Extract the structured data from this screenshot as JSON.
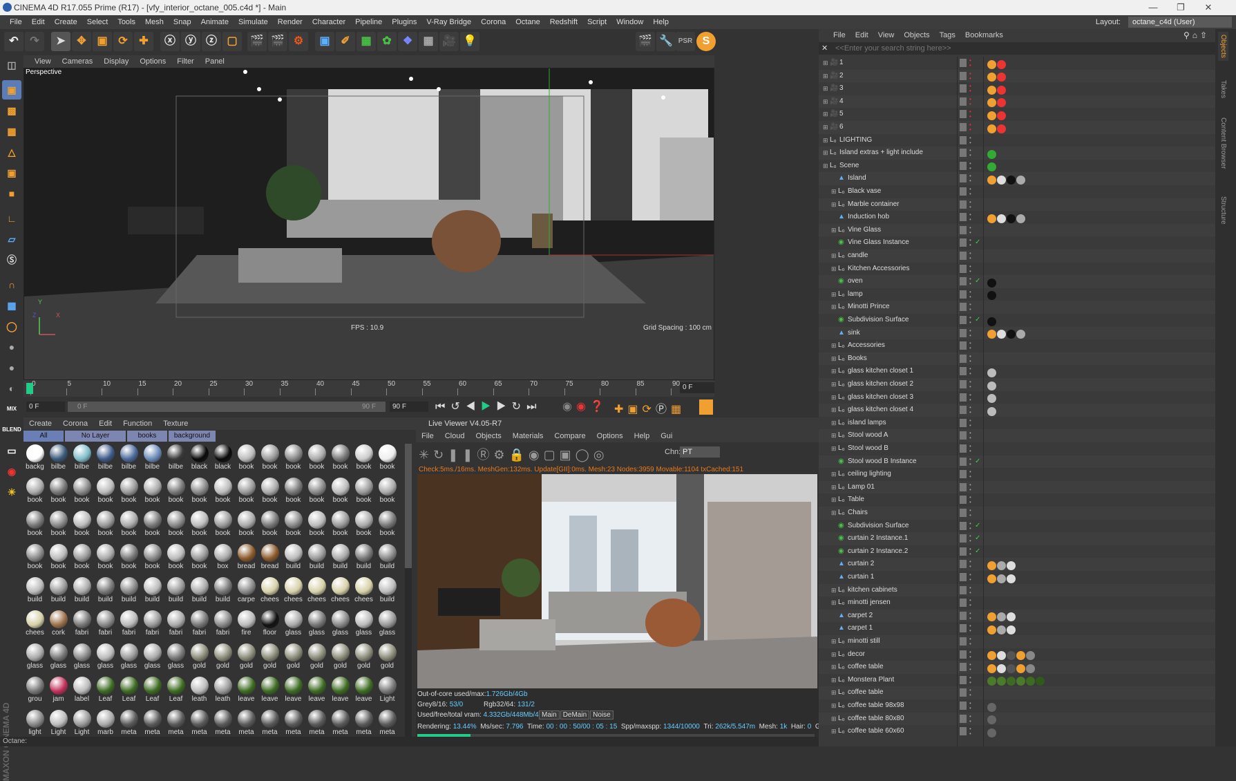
{
  "window": {
    "title": "CINEMA 4D R17.055 Prime (R17) - [vfy_interior_octane_005.c4d *] - Main"
  },
  "menubar": {
    "items": [
      "File",
      "Edit",
      "Create",
      "Select",
      "Tools",
      "Mesh",
      "Snap",
      "Animate",
      "Simulate",
      "Render",
      "Character",
      "Pipeline",
      "Plugins",
      "V-Ray Bridge",
      "Corona",
      "Octane",
      "Redshift",
      "Script",
      "Window",
      "Help"
    ],
    "layout_label": "Layout:",
    "layout_value": "octane_c4d (User)"
  },
  "viewport": {
    "menu": [
      "View",
      "Cameras",
      "Display",
      "Options",
      "Filter",
      "Panel"
    ],
    "label": "Perspective",
    "fps": "FPS : 10.9",
    "grid_spacing": "Grid Spacing : 100 cm",
    "axis_y": "Y",
    "axis_x": "X",
    "axis_z": "Z"
  },
  "timeline": {
    "ticks": [
      "0",
      "5",
      "10",
      "15",
      "20",
      "25",
      "30",
      "35",
      "40",
      "45",
      "50",
      "55",
      "60",
      "65",
      "70",
      "75",
      "80",
      "85",
      "90"
    ],
    "current_frame": "0 F",
    "start_field": "0 F",
    "range_start": "0 F",
    "range_end": "90 F",
    "end_field": "90 F"
  },
  "material_manager": {
    "menu": [
      "Create",
      "Corona",
      "Edit",
      "Function",
      "Texture"
    ],
    "filters": [
      "All",
      "No Layer",
      "books",
      "background"
    ],
    "materials": [
      "backg",
      "bilbe",
      "bilbe",
      "bilbe",
      "bilbe",
      "bilbe",
      "bilbe",
      "black",
      "black",
      "book",
      "book",
      "book",
      "book",
      "book",
      "book",
      "book",
      "book",
      "book",
      "book",
      "book",
      "book",
      "book",
      "book",
      "book",
      "book",
      "book",
      "book",
      "book",
      "book",
      "book",
      "book",
      "book",
      "book",
      "book",
      "book",
      "book",
      "book",
      "book",
      "book",
      "book",
      "book",
      "book",
      "book",
      "book",
      "book",
      "book",
      "book",
      "book",
      "book",
      "book",
      "book",
      "book",
      "book",
      "book",
      "book",
      "book",
      "box",
      "bread",
      "bread",
      "build",
      "build",
      "build",
      "build",
      "build",
      "build",
      "build",
      "build",
      "build",
      "build",
      "build",
      "build",
      "build",
      "build",
      "carpe",
      "chees",
      "chees",
      "chees",
      "chees",
      "chees",
      "build",
      "chees",
      "cork",
      "fabri",
      "fabri",
      "fabri",
      "fabri",
      "fabri",
      "fabri",
      "fabri",
      "fire",
      "floor",
      "glass",
      "glass",
      "glass",
      "glass",
      "glass",
      "glass",
      "glass",
      "glass",
      "glass",
      "glass",
      "glass",
      "glass",
      "gold",
      "gold",
      "gold",
      "gold",
      "gold",
      "gold",
      "gold",
      "gold",
      "gold",
      "grou",
      "jam",
      "label",
      "Leaf",
      "Leaf",
      "Leaf",
      "Leaf",
      "leath",
      "leath",
      "leave",
      "leave",
      "leave",
      "leave",
      "leave",
      "leave",
      "Light",
      "light",
      "Light",
      "Light",
      "marb",
      "meta",
      "meta",
      "meta",
      "meta",
      "meta",
      "meta",
      "meta",
      "meta",
      "meta",
      "meta",
      "meta",
      "meta"
    ],
    "brand": "MAXON CINEMA 4D"
  },
  "live_viewer": {
    "title": "Live Viewer V4.05-R7",
    "menu": [
      "File",
      "Cloud",
      "Objects",
      "Materials",
      "Compare",
      "Options",
      "Help",
      "Gui"
    ],
    "channel_label": "Chn:",
    "channel_value": "PT",
    "status_line": "Check:5ms./16ms. MeshGen:132ms. Update[GII]:0ms. Mesh:23 Nodes:3959 Movable:1104 txCached:151",
    "out_of_core_label": "Out-of-core used/max:",
    "out_of_core_value": "1.726Gb/4Gb",
    "grey_label": "Grey8/16:",
    "grey_value": "53/0",
    "rgb_label": "Rgb32/64:",
    "rgb_value": "131/2",
    "vram_label": "Used/free/total vram:",
    "vram_value": "4.332Gb/448Mb/4Gb",
    "passes": [
      "Main",
      "DeMain",
      "Noise"
    ],
    "rendering_label": "Rendering:",
    "rendering_value": "13.44%",
    "ms_label": "Ms/sec:",
    "ms_value": "7.796",
    "time_label": "Time:",
    "time_value": "00 : 00 : 50/00 : 05 : 15",
    "spp_label": "Spp/maxspp:",
    "spp_value": "1344/10000",
    "tri_label": "Tri:",
    "tri_value": "262k/5.547m",
    "mesh_label": "Mesh:",
    "mesh_value": "1k",
    "hair_label": "Hair:",
    "hair_value": "0",
    "gpl": "GPL",
    "progress": 0.1344
  },
  "object_manager": {
    "menu": [
      "File",
      "Edit",
      "View",
      "Objects",
      "Tags",
      "Bookmarks"
    ],
    "search_placeholder": "<<Enter your search string here>>",
    "objects": [
      {
        "name": "1",
        "kind": "camera"
      },
      {
        "name": "2",
        "kind": "camera"
      },
      {
        "name": "3",
        "kind": "camera"
      },
      {
        "name": "4",
        "kind": "camera"
      },
      {
        "name": "5",
        "kind": "camera"
      },
      {
        "name": "6",
        "kind": "camera"
      },
      {
        "name": "LIGHTING",
        "kind": "null"
      },
      {
        "name": "Island extras + light include",
        "kind": "null"
      },
      {
        "name": "Scene",
        "kind": "null"
      },
      {
        "name": "Island",
        "kind": "poly"
      },
      {
        "name": "Black vase",
        "kind": "null"
      },
      {
        "name": "Marble container",
        "kind": "null"
      },
      {
        "name": "Induction hob",
        "kind": "poly"
      },
      {
        "name": "Vine Glass",
        "kind": "null"
      },
      {
        "name": "Vine Glass Instance",
        "kind": "inst"
      },
      {
        "name": "candle",
        "kind": "null"
      },
      {
        "name": "Kitchen Accessories",
        "kind": "null"
      },
      {
        "name": "oven",
        "kind": "sds"
      },
      {
        "name": "lamp",
        "kind": "null"
      },
      {
        "name": "Minotti Prince",
        "kind": "null"
      },
      {
        "name": "Subdivision Surface",
        "kind": "sds"
      },
      {
        "name": "sink",
        "kind": "poly"
      },
      {
        "name": "Accessories",
        "kind": "null"
      },
      {
        "name": "Books",
        "kind": "null"
      },
      {
        "name": "glass kitchen closet 1",
        "kind": "null"
      },
      {
        "name": "glass kitchen closet 2",
        "kind": "null"
      },
      {
        "name": "glass kitchen closet 3",
        "kind": "null"
      },
      {
        "name": "glass kitchen closet 4",
        "kind": "null"
      },
      {
        "name": "island lamps",
        "kind": "null"
      },
      {
        "name": "Stool wood A",
        "kind": "null"
      },
      {
        "name": "Stool wood B",
        "kind": "null"
      },
      {
        "name": "Stool wood B Instance",
        "kind": "inst"
      },
      {
        "name": "ceiling lighting",
        "kind": "null"
      },
      {
        "name": "Lamp 01",
        "kind": "null"
      },
      {
        "name": "Table",
        "kind": "null"
      },
      {
        "name": "Chairs",
        "kind": "null"
      },
      {
        "name": "Subdivision Surface",
        "kind": "sds"
      },
      {
        "name": "curtain 2 Instance.1",
        "kind": "inst"
      },
      {
        "name": "curtain 2 Instance.2",
        "kind": "inst"
      },
      {
        "name": "curtain 2",
        "kind": "poly"
      },
      {
        "name": "curtain 1",
        "kind": "poly"
      },
      {
        "name": "kitchen cabinets",
        "kind": "null"
      },
      {
        "name": "minotti jensen",
        "kind": "null"
      },
      {
        "name": "carpet 2",
        "kind": "poly"
      },
      {
        "name": "carpet 1",
        "kind": "poly"
      },
      {
        "name": "minotti still",
        "kind": "null"
      },
      {
        "name": "decor",
        "kind": "null"
      },
      {
        "name": "coffee table",
        "kind": "null"
      },
      {
        "name": "Monstera Plant",
        "kind": "null"
      },
      {
        "name": "coffee table",
        "kind": "null"
      },
      {
        "name": "coffee table 98x98",
        "kind": "null"
      },
      {
        "name": "coffee table 80x80",
        "kind": "null"
      },
      {
        "name": "coffee table 60x60",
        "kind": "null"
      }
    ]
  },
  "side_tabs": [
    "Objects",
    "Takes",
    "Content Browser",
    "Structure"
  ],
  "status_bar": "Octane:",
  "colors": {
    "accent": "#f0a030",
    "selection": "#5a7db8",
    "octane_orange": "#e8571c"
  }
}
